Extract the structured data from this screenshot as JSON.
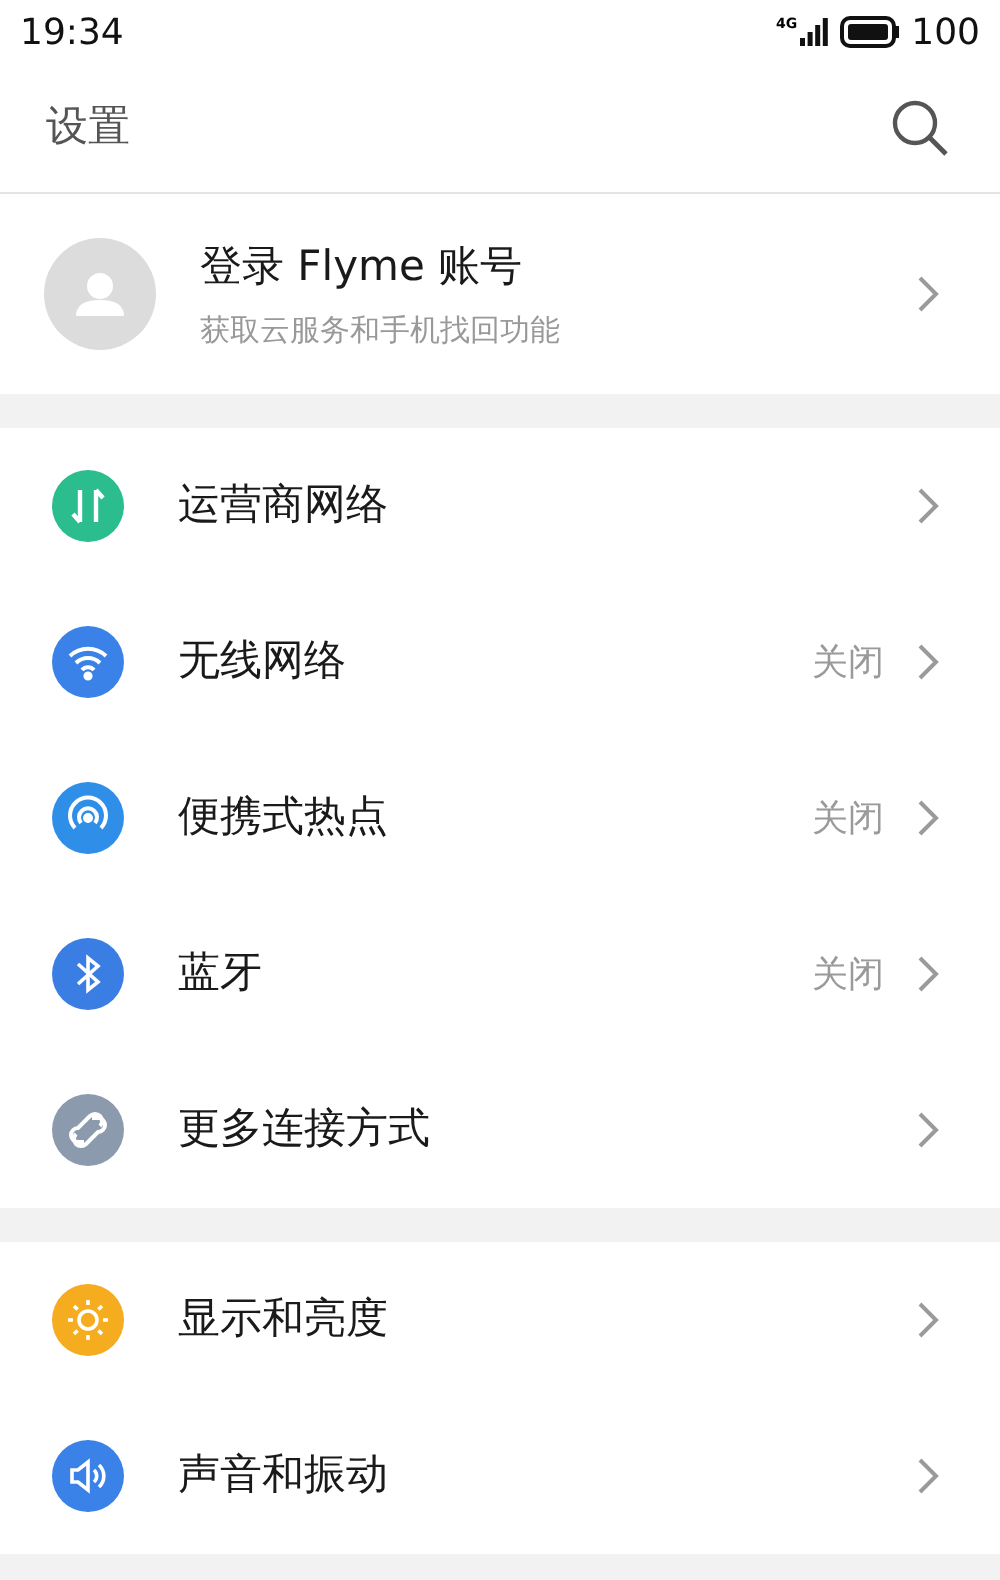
{
  "status_bar": {
    "time": "19:34",
    "network": "4G",
    "battery": "100"
  },
  "header": {
    "title": "设置"
  },
  "account": {
    "title": "登录 Flyme 账号",
    "subtitle": "获取云服务和手机找回功能"
  },
  "groups": [
    {
      "items": [
        {
          "kind": "carrier",
          "label": "运营商网络"
        },
        {
          "kind": "wifi",
          "label": "无线网络",
          "value": "关闭"
        },
        {
          "kind": "hotspot",
          "label": "便携式热点",
          "value": "关闭"
        },
        {
          "kind": "bluetooth",
          "label": "蓝牙",
          "value": "关闭"
        },
        {
          "kind": "link",
          "label": "更多连接方式"
        }
      ]
    },
    {
      "items": [
        {
          "kind": "display",
          "label": "显示和亮度"
        },
        {
          "kind": "sound",
          "label": "声音和振动"
        }
      ]
    }
  ]
}
